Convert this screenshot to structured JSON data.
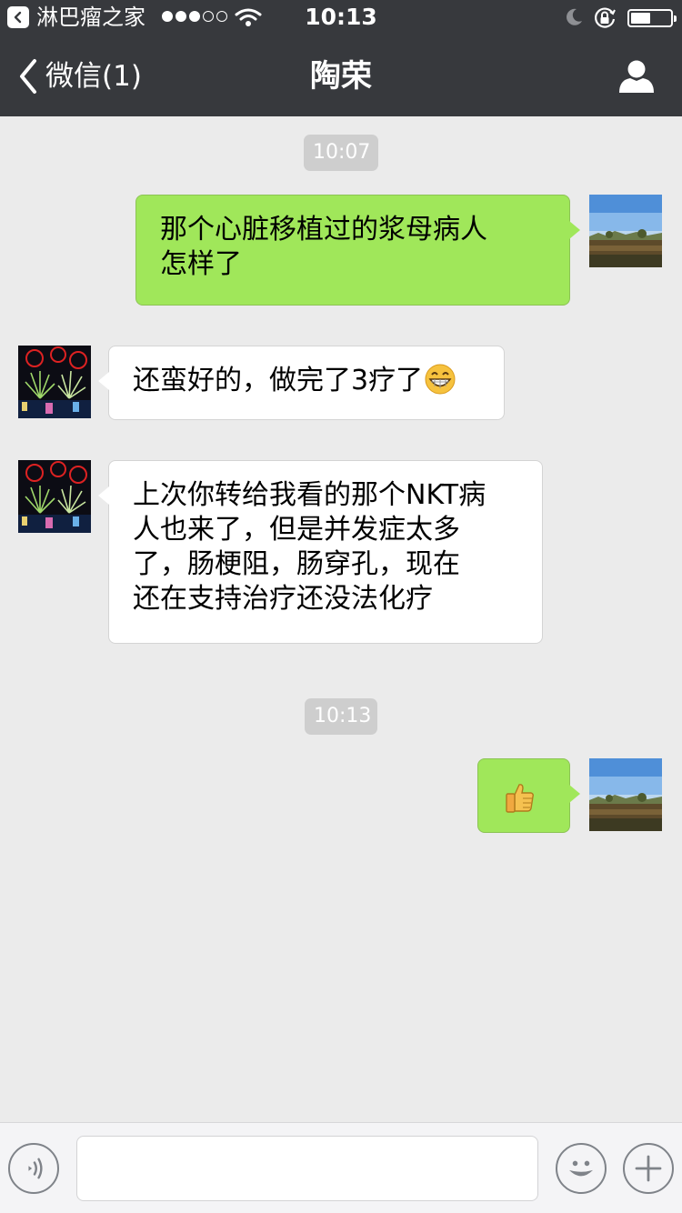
{
  "status_bar": {
    "back_app": "淋巴瘤之家",
    "signal_dots": 5,
    "signal_filled": 3,
    "time": "10:13",
    "battery_level": 0.55
  },
  "nav": {
    "back_label": "微信(1)",
    "title": "陶荣",
    "profile_icon": "person-icon"
  },
  "messages": [
    {
      "type": "timestamp",
      "text": "10:07"
    },
    {
      "type": "message",
      "side": "out",
      "text": "那个心脏移植过的浆母病人\n怎样了"
    },
    {
      "type": "message",
      "side": "in",
      "text": "还蛮好的，做完了3疗了",
      "emoji": "grinning-face-emoji"
    },
    {
      "type": "message",
      "side": "in",
      "text": "上次你转给我看的那个NKT病\n人也来了，但是并发症太多\n了，肠梗阻，肠穿孔，现在\n还在支持治疗还没法化疗"
    },
    {
      "type": "timestamp",
      "text": "10:13"
    },
    {
      "type": "message",
      "side": "out",
      "emoji": "thumbs-up-emoji"
    }
  ],
  "input_bar": {
    "voice_icon": "voice-icon",
    "emoji_icon": "smiley-icon",
    "plus_icon": "plus-icon",
    "input_value": ""
  },
  "colors": {
    "nav_bg": "#37393d",
    "chat_bg": "#ebebeb",
    "outgoing_bubble": "#a0e75a",
    "incoming_bubble": "#ffffff",
    "timestamp_bg": "#cecece"
  }
}
